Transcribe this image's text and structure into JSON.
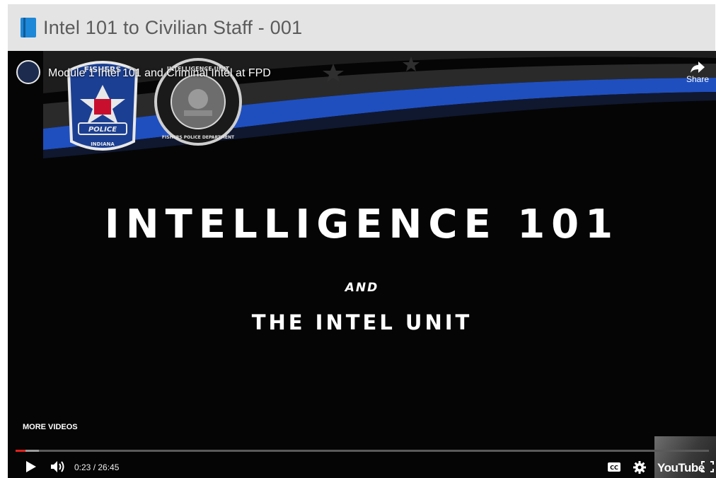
{
  "page": {
    "title": "Intel 101 to Civilian Staff - 001"
  },
  "video": {
    "title": "Module 1 Intel 101 and Criminal Intel at FPD",
    "share_label": "Share",
    "more_videos_label": "MORE VIDEOS",
    "time": "0:23 / 26:45",
    "progress_fraction": 0.0145,
    "brand": "YouTube"
  },
  "slide": {
    "heading": "INTELLIGENCE 101",
    "and": "AND",
    "subheading": "THE INTEL UNIT",
    "badge_left_top": "FISHERS",
    "badge_left_mid": "POLICE",
    "badge_left_bottom": "INDIANA",
    "badge_right_top": "INTELLIGENCE UNIT",
    "badge_right_bottom": "FISHERS POLICE DEPARTMENT"
  },
  "colors": {
    "header_bg": "#e4e4e4",
    "accent_blue": "#1e88d8",
    "progress_red": "#e3211c",
    "flag_blue": "#1f4fbf"
  },
  "icons": [
    "book-icon",
    "share-icon",
    "play-icon",
    "volume-icon",
    "cc-icon",
    "settings-icon",
    "fullscreen-icon"
  ]
}
